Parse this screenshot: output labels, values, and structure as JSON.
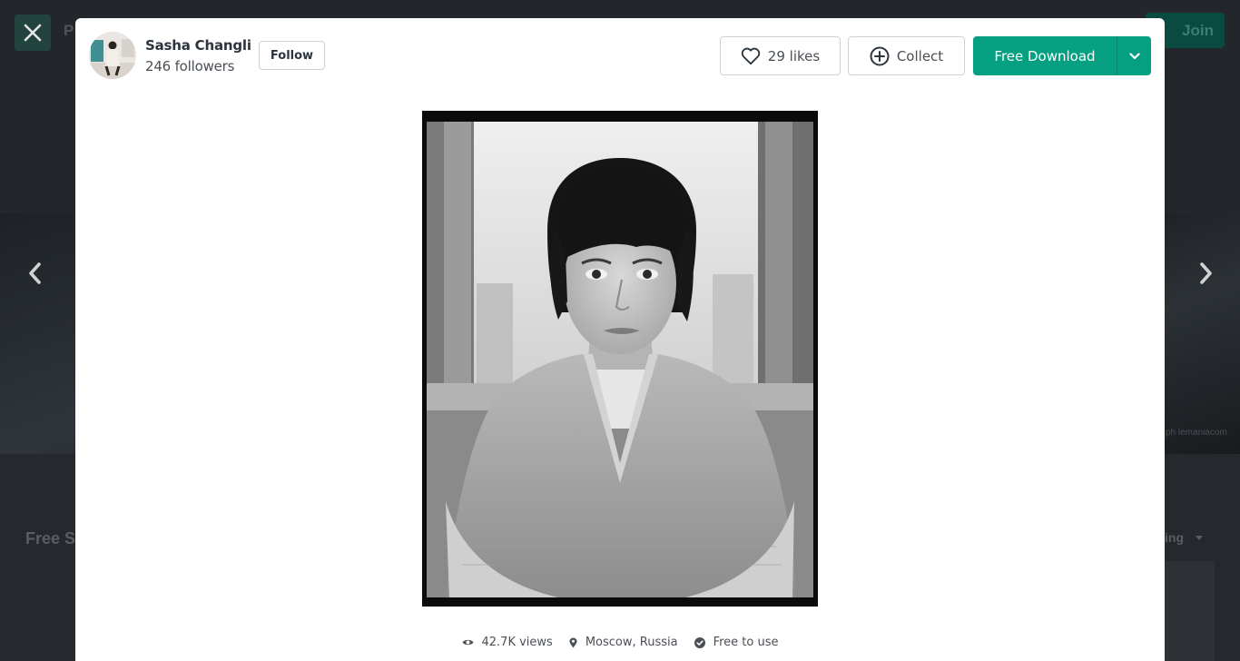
{
  "background": {
    "header_peek": "P",
    "join_label": "Join",
    "section_title": "Free S",
    "sort_peek": "ing",
    "credit_peek": "ph lemaniacom"
  },
  "modal": {
    "author": {
      "name": "Sasha Changli",
      "followers": "246 followers",
      "follow_label": "Follow"
    },
    "actions": {
      "likes_label": "29 likes",
      "collect_label": "Collect",
      "download_label": "Free Download"
    },
    "meta": {
      "views": "42.7K views",
      "location": "Moscow, Russia",
      "license": "Free to use"
    }
  },
  "colors": {
    "accent": "#05a081",
    "text_dark": "#2c343e",
    "text_muted": "#4a4f55",
    "border": "#d1d1d1"
  },
  "icons": {
    "close": "close-icon",
    "prev": "chevron-left-icon",
    "next": "chevron-right-icon",
    "like": "heart-icon",
    "collect": "plus-circle-icon",
    "download_more": "chevron-down-icon",
    "views": "eye-icon",
    "location": "map-pin-icon",
    "license": "check-circle-icon"
  }
}
